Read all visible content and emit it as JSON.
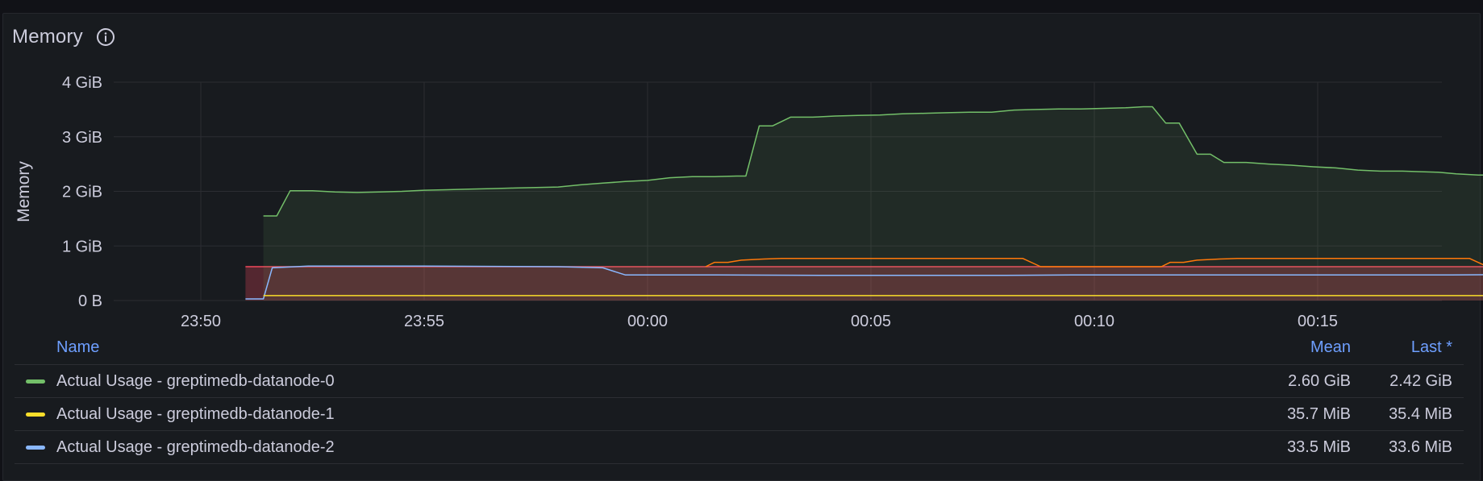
{
  "panel": {
    "title": "Memory",
    "info_icon": "info-circle-icon"
  },
  "legend": {
    "headers": {
      "name": "Name",
      "mean": "Mean",
      "last": "Last *"
    },
    "rows": [
      {
        "name": "Actual Usage - greptimedb-datanode-0",
        "mean": "2.60 GiB",
        "last": "2.42 GiB",
        "color": "#73bf69"
      },
      {
        "name": "Actual Usage - greptimedb-datanode-1",
        "mean": "35.7 MiB",
        "last": "35.4 MiB",
        "color": "#fade2a"
      },
      {
        "name": "Actual Usage - greptimedb-datanode-2",
        "mean": "33.5 MiB",
        "last": "33.6 MiB",
        "color": "#8ab8ff"
      }
    ]
  },
  "chart_data": {
    "type": "area",
    "ylabel": "Memory",
    "y_ticks": [
      "0 B",
      "1 GiB",
      "2 GiB",
      "3 GiB",
      "4 GiB"
    ],
    "ylim": [
      0,
      4
    ],
    "x_ticks": [
      "23:50",
      "23:55",
      "00:00",
      "00:05",
      "00:10",
      "00:15"
    ],
    "x_unit": "minutes relative to 00:00",
    "xlim": [
      -12.6,
      17.7
    ],
    "grid": true,
    "series": [
      {
        "name": "Actual Usage - greptimedb-datanode-0",
        "color": "#73bf69",
        "unit": "GiB",
        "fill": true,
        "points": [
          [
            -8.6,
            1.55
          ],
          [
            -8.3,
            1.55
          ],
          [
            -8.0,
            2.01
          ],
          [
            -7.5,
            2.01
          ],
          [
            -7.0,
            1.99
          ],
          [
            -6.5,
            1.98
          ],
          [
            -6.0,
            1.99
          ],
          [
            -5.5,
            2.0
          ],
          [
            -5.0,
            2.02
          ],
          [
            -4.5,
            2.03
          ],
          [
            -4.0,
            2.04
          ],
          [
            -3.5,
            2.05
          ],
          [
            -3.0,
            2.06
          ],
          [
            -2.5,
            2.07
          ],
          [
            -2.0,
            2.08
          ],
          [
            -1.5,
            2.12
          ],
          [
            -1.0,
            2.15
          ],
          [
            -0.5,
            2.18
          ],
          [
            0.0,
            2.2
          ],
          [
            0.5,
            2.25
          ],
          [
            1.0,
            2.27
          ],
          [
            1.5,
            2.27
          ],
          [
            2.0,
            2.28
          ],
          [
            2.2,
            2.28
          ],
          [
            2.5,
            3.2
          ],
          [
            2.8,
            3.2
          ],
          [
            3.2,
            3.36
          ],
          [
            3.7,
            3.36
          ],
          [
            4.2,
            3.38
          ],
          [
            4.7,
            3.39
          ],
          [
            5.2,
            3.4
          ],
          [
            5.7,
            3.42
          ],
          [
            6.2,
            3.43
          ],
          [
            6.7,
            3.44
          ],
          [
            7.2,
            3.45
          ],
          [
            7.7,
            3.45
          ],
          [
            8.2,
            3.49
          ],
          [
            8.7,
            3.5
          ],
          [
            9.2,
            3.51
          ],
          [
            9.7,
            3.51
          ],
          [
            10.2,
            3.52
          ],
          [
            10.7,
            3.53
          ],
          [
            11.1,
            3.55
          ],
          [
            11.3,
            3.55
          ],
          [
            11.6,
            3.25
          ],
          [
            11.9,
            3.25
          ],
          [
            12.3,
            2.68
          ],
          [
            12.6,
            2.68
          ],
          [
            12.9,
            2.53
          ],
          [
            13.4,
            2.53
          ],
          [
            13.9,
            2.5
          ],
          [
            14.4,
            2.48
          ],
          [
            14.9,
            2.45
          ],
          [
            15.4,
            2.43
          ],
          [
            15.9,
            2.39
          ],
          [
            16.4,
            2.37
          ],
          [
            16.9,
            2.37
          ],
          [
            17.3,
            2.36
          ],
          [
            17.7,
            2.35
          ],
          [
            18.1,
            2.32
          ],
          [
            18.6,
            2.3
          ],
          [
            19.1,
            2.3
          ],
          [
            19.6,
            2.31
          ],
          [
            20.1,
            2.33
          ],
          [
            20.6,
            2.34
          ],
          [
            21.1,
            2.36
          ],
          [
            21.6,
            2.37
          ],
          [
            22.1,
            2.38
          ],
          [
            22.6,
            2.39
          ],
          [
            23.1,
            2.4
          ],
          [
            23.6,
            2.41
          ],
          [
            24.2,
            2.42
          ]
        ]
      },
      {
        "name": "Actual Usage - greptimedb-datanode-1",
        "color": "#fade2a",
        "unit": "GiB",
        "fill": false,
        "points": [
          [
            -8.6,
            0.09
          ],
          [
            24.2,
            0.09
          ]
        ]
      },
      {
        "name": "Actual Usage - greptimedb-datanode-2",
        "color": "#8ab8ff",
        "unit": "GiB",
        "fill": false,
        "points": [
          [
            -9.0,
            0.03
          ],
          [
            -8.6,
            0.03
          ],
          [
            -8.4,
            0.6
          ],
          [
            -7.6,
            0.63
          ],
          [
            -5.0,
            0.63
          ],
          [
            -2.0,
            0.62
          ],
          [
            -1.0,
            0.6
          ],
          [
            -0.5,
            0.47
          ],
          [
            1.5,
            0.47
          ],
          [
            4.0,
            0.46
          ],
          [
            8.0,
            0.46
          ],
          [
            9.5,
            0.47
          ],
          [
            12.5,
            0.47
          ],
          [
            15.0,
            0.47
          ],
          [
            18.0,
            0.47
          ],
          [
            20.0,
            0.48
          ],
          [
            24.2,
            0.47
          ]
        ]
      },
      {
        "name": "",
        "color": "#f2495c",
        "unit": "GiB",
        "fill": true,
        "points": [
          [
            -9.0,
            0.62
          ],
          [
            24.2,
            0.62
          ]
        ]
      },
      {
        "name": "",
        "color": "#ff780a",
        "unit": "GiB",
        "fill": false,
        "points": [
          [
            1.3,
            0.62
          ],
          [
            1.5,
            0.7
          ],
          [
            1.8,
            0.7
          ],
          [
            2.1,
            0.74
          ],
          [
            2.6,
            0.76
          ],
          [
            3.0,
            0.77
          ],
          [
            8.4,
            0.77
          ],
          [
            8.8,
            0.62
          ],
          [
            11.5,
            0.62
          ],
          [
            11.7,
            0.7
          ],
          [
            12.0,
            0.7
          ],
          [
            12.3,
            0.74
          ],
          [
            12.8,
            0.76
          ],
          [
            13.2,
            0.77
          ],
          [
            18.4,
            0.77
          ],
          [
            18.8,
            0.62
          ]
        ]
      }
    ]
  }
}
